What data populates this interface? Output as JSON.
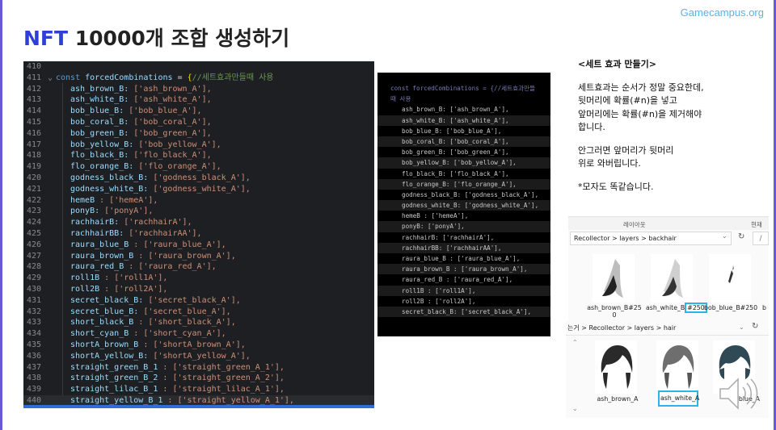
{
  "brand": "Gamecampus.org",
  "title": {
    "accent": "NFT",
    "rest": " 10000개 조합 생성하기"
  },
  "editor": {
    "lines": [
      {
        "num": "410",
        "code": ""
      },
      {
        "num": "411",
        "code": "const forcedCombinations = {//세트효과만들때 사용",
        "kind": "header"
      },
      {
        "num": "412",
        "key": "ash_brown_B:",
        "val": "['ash_brown_A'],",
        "sp": " "
      },
      {
        "num": "413",
        "key": "ash_white_B:",
        "val": "['ash_white_A'],",
        "sp": " "
      },
      {
        "num": "414",
        "key": "bob_blue_B:",
        "val": "['bob_blue_A'],",
        "sp": " "
      },
      {
        "num": "415",
        "key": "bob_coral_B:",
        "val": "['bob_coral_A'],",
        "sp": " "
      },
      {
        "num": "416",
        "key": "bob_green_B:",
        "val": "['bob_green_A'],",
        "sp": " "
      },
      {
        "num": "417",
        "key": "bob_yellow_B:",
        "val": "['bob_yellow_A'],",
        "sp": " "
      },
      {
        "num": "418",
        "key": "flo_black_B:",
        "val": "['flo_black_A'],",
        "sp": " "
      },
      {
        "num": "419",
        "key": "flo_orange_B:",
        "val": "['flo_orange_A'],",
        "sp": " "
      },
      {
        "num": "420",
        "key": "godness_black_B:",
        "val": "['godness_black_A'],",
        "sp": " "
      },
      {
        "num": "421",
        "key": "godness_white_B:",
        "val": "['godness_white_A'],",
        "sp": " "
      },
      {
        "num": "422",
        "key": "hemeB",
        "val": ": ['hemeA'],",
        "sp": " "
      },
      {
        "num": "423",
        "key": "ponyB:",
        "val": "['ponyA'],",
        "sp": " "
      },
      {
        "num": "424",
        "key": "rachhairB:",
        "val": "['rachhairA'],",
        "sp": " "
      },
      {
        "num": "425",
        "key": "rachhairBB:",
        "val": "['rachhairAA'],",
        "sp": " "
      },
      {
        "num": "426",
        "key": "raura_blue_B",
        "val": ": ['raura_blue_A'],",
        "sp": " "
      },
      {
        "num": "427",
        "key": "raura_brown_B",
        "val": ": ['raura_brown_A'],",
        "sp": " "
      },
      {
        "num": "428",
        "key": "raura_red_B",
        "val": ": ['raura_red_A'],",
        "sp": " "
      },
      {
        "num": "429",
        "key": "roll1B",
        "val": ": ['roll1A'],",
        "sp": " "
      },
      {
        "num": "430",
        "key": "roll2B",
        "val": ": ['roll2A'],",
        "sp": " "
      },
      {
        "num": "431",
        "key": "secret_black_B:",
        "val": "['secret_black_A'],",
        "sp": " "
      },
      {
        "num": "432",
        "key": "secret_blue_B:",
        "val": "['secret_blue_A'],",
        "sp": " "
      },
      {
        "num": "433",
        "key": "short_black_B",
        "val": ": ['short_black_A'],",
        "sp": " "
      },
      {
        "num": "434",
        "key": "short_cyan_B",
        "val": ": ['short_cyan_A'],",
        "sp": " "
      },
      {
        "num": "435",
        "key": "shortA_brown_B",
        "val": ": ['shortA_brown_A'],",
        "sp": " "
      },
      {
        "num": "436",
        "key": "shortA_yellow_B:",
        "val": "['shortA_yellow_A'],",
        "sp": " "
      },
      {
        "num": "437",
        "key": "straight_green_B_1",
        "val": ": ['straight_green_A_1'],",
        "sp": " "
      },
      {
        "num": "438",
        "key": "straight_green_B_2",
        "val": ": ['straight_green_A_2'],",
        "sp": " "
      },
      {
        "num": "439",
        "key": "straight_lilac_B_1",
        "val": ": ['straight_lilac_A_1'],",
        "sp": " "
      },
      {
        "num": "440",
        "key": "straight_yellow_B_1",
        "val": ": ['straight_yellow_A_1'],",
        "sp": " "
      }
    ]
  },
  "midcode": {
    "header1": "const forcedCombinations = {//세트효과만들",
    "header2": "때 사용",
    "lines": [
      "ash_brown_B: ['ash_brown_A'],",
      "ash_white_B: ['ash_white_A'],",
      "bob_blue_B: ['bob_blue_A'],",
      "bob_coral_B: ['bob_coral_A'],",
      "bob_green_B: ['bob_green_A'],",
      "bob_yellow_B: ['bob_yellow_A'],",
      "flo_black_B: ['flo_black_A'],",
      "flo_orange_B: ['flo_orange_A'],",
      "godness_black_B: ['godness_black_A'],",
      "godness_white_B: ['godness_white_A'],",
      "hemeB : ['hemeA'],",
      "ponyB: ['ponyA'],",
      "rachhairB: ['rachhairA'],",
      "rachhairBB: ['rachhairAA'],",
      "raura_blue_B : ['raura_blue_A'],",
      "raura_brown_B : ['raura_brown_A'],",
      "raura_red_B : ['raura_red_A'],",
      "roll1B : ['roll1A'],",
      "roll2B : ['roll2A'],",
      "secret_black_B: ['secret_black_A'],"
    ]
  },
  "notes": {
    "heading": "<세트 효과 만들기>",
    "p1_l1": "세트효과는 순서가 정말 중요한데,",
    "p1_l2": "뒷머리에 확률(#n)을 넣고",
    "p1_l3": "앞머리에는 확률(#n)을 제거해야",
    "p1_l4": "합니다.",
    "p2_l1": "안그러면 앞머리가 뒷머리",
    "p2_l2": "위로 와버립니다.",
    "p3": "*모자도 똑같습니다."
  },
  "explorer1": {
    "tab_layout": "레이아웃",
    "tab_current": "현재",
    "path": "Recollector  >  layers  >  backhair",
    "files": [
      {
        "line1": "ash_brown_B#25",
        "line2": "0"
      },
      {
        "pre": "ash_white_B",
        "hl": "#250"
      },
      {
        "line1": "bob_blue_B#250"
      },
      {
        "line1": "b"
      }
    ]
  },
  "explorer2": {
    "path": "는거  >  Recollector  >  layers  >  hair",
    "files": [
      {
        "name": "ash_brown_A"
      },
      {
        "name": "ash_white_A"
      },
      {
        "name": "_blue_A"
      }
    ]
  },
  "colors": {
    "accent": "#2d3fd6",
    "highlight": "#29b6e6",
    "frame": "#6a5ad6"
  }
}
